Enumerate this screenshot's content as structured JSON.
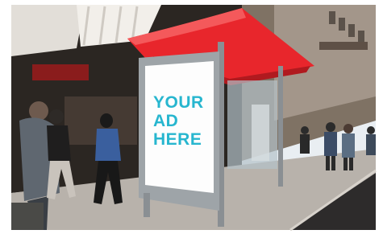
{
  "ad_panel": {
    "line1": "YOUR",
    "line2": "AD",
    "line3": "HERE",
    "text_color": "#27b6cf"
  },
  "colors": {
    "shelter_roof": "#e8262c",
    "sky": "#e9eef2",
    "sidewalk": "#b8b2ab"
  }
}
